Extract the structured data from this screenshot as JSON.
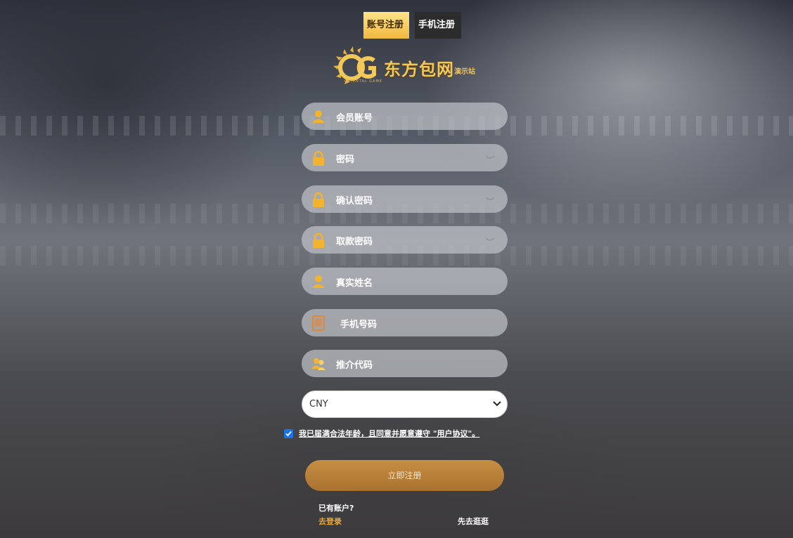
{
  "tabs": [
    {
      "label": "账号注册",
      "active": true
    },
    {
      "label": "手机注册",
      "active": false
    }
  ],
  "logo": {
    "name": "东方包网",
    "sub": "演示站",
    "small": "ORIENTAL GAME",
    "letters": "OG"
  },
  "fields": [
    {
      "placeholder": "会员账号",
      "icon": "user-icon"
    },
    {
      "placeholder": "密码",
      "icon": "lock-icon",
      "toggle": "eye-closed-icon"
    },
    {
      "placeholder": "确认密码",
      "icon": "lock-icon",
      "toggle": "eye-closed-icon"
    },
    {
      "placeholder": "取款密码",
      "icon": "lock-icon",
      "toggle": "eye-closed-icon"
    },
    {
      "placeholder": "真实姓名",
      "icon": "user-icon"
    },
    {
      "placeholder": "手机号码",
      "icon": "phone-icon"
    },
    {
      "placeholder": "推介代码",
      "icon": "users-icon"
    }
  ],
  "currency": {
    "selected": "CNY"
  },
  "agreement": {
    "checked": true,
    "text": "我已届满合法年龄，且同意并愿意遵守 \"用户协议\"。"
  },
  "submit_label": "立即注册",
  "footer": {
    "have_account": "已有账户?",
    "login": "去登录",
    "browse": "先去逛逛"
  },
  "colors": {
    "accent": "#e9a83a",
    "tab_active": "#f1b83d",
    "submit": "#b98037"
  }
}
